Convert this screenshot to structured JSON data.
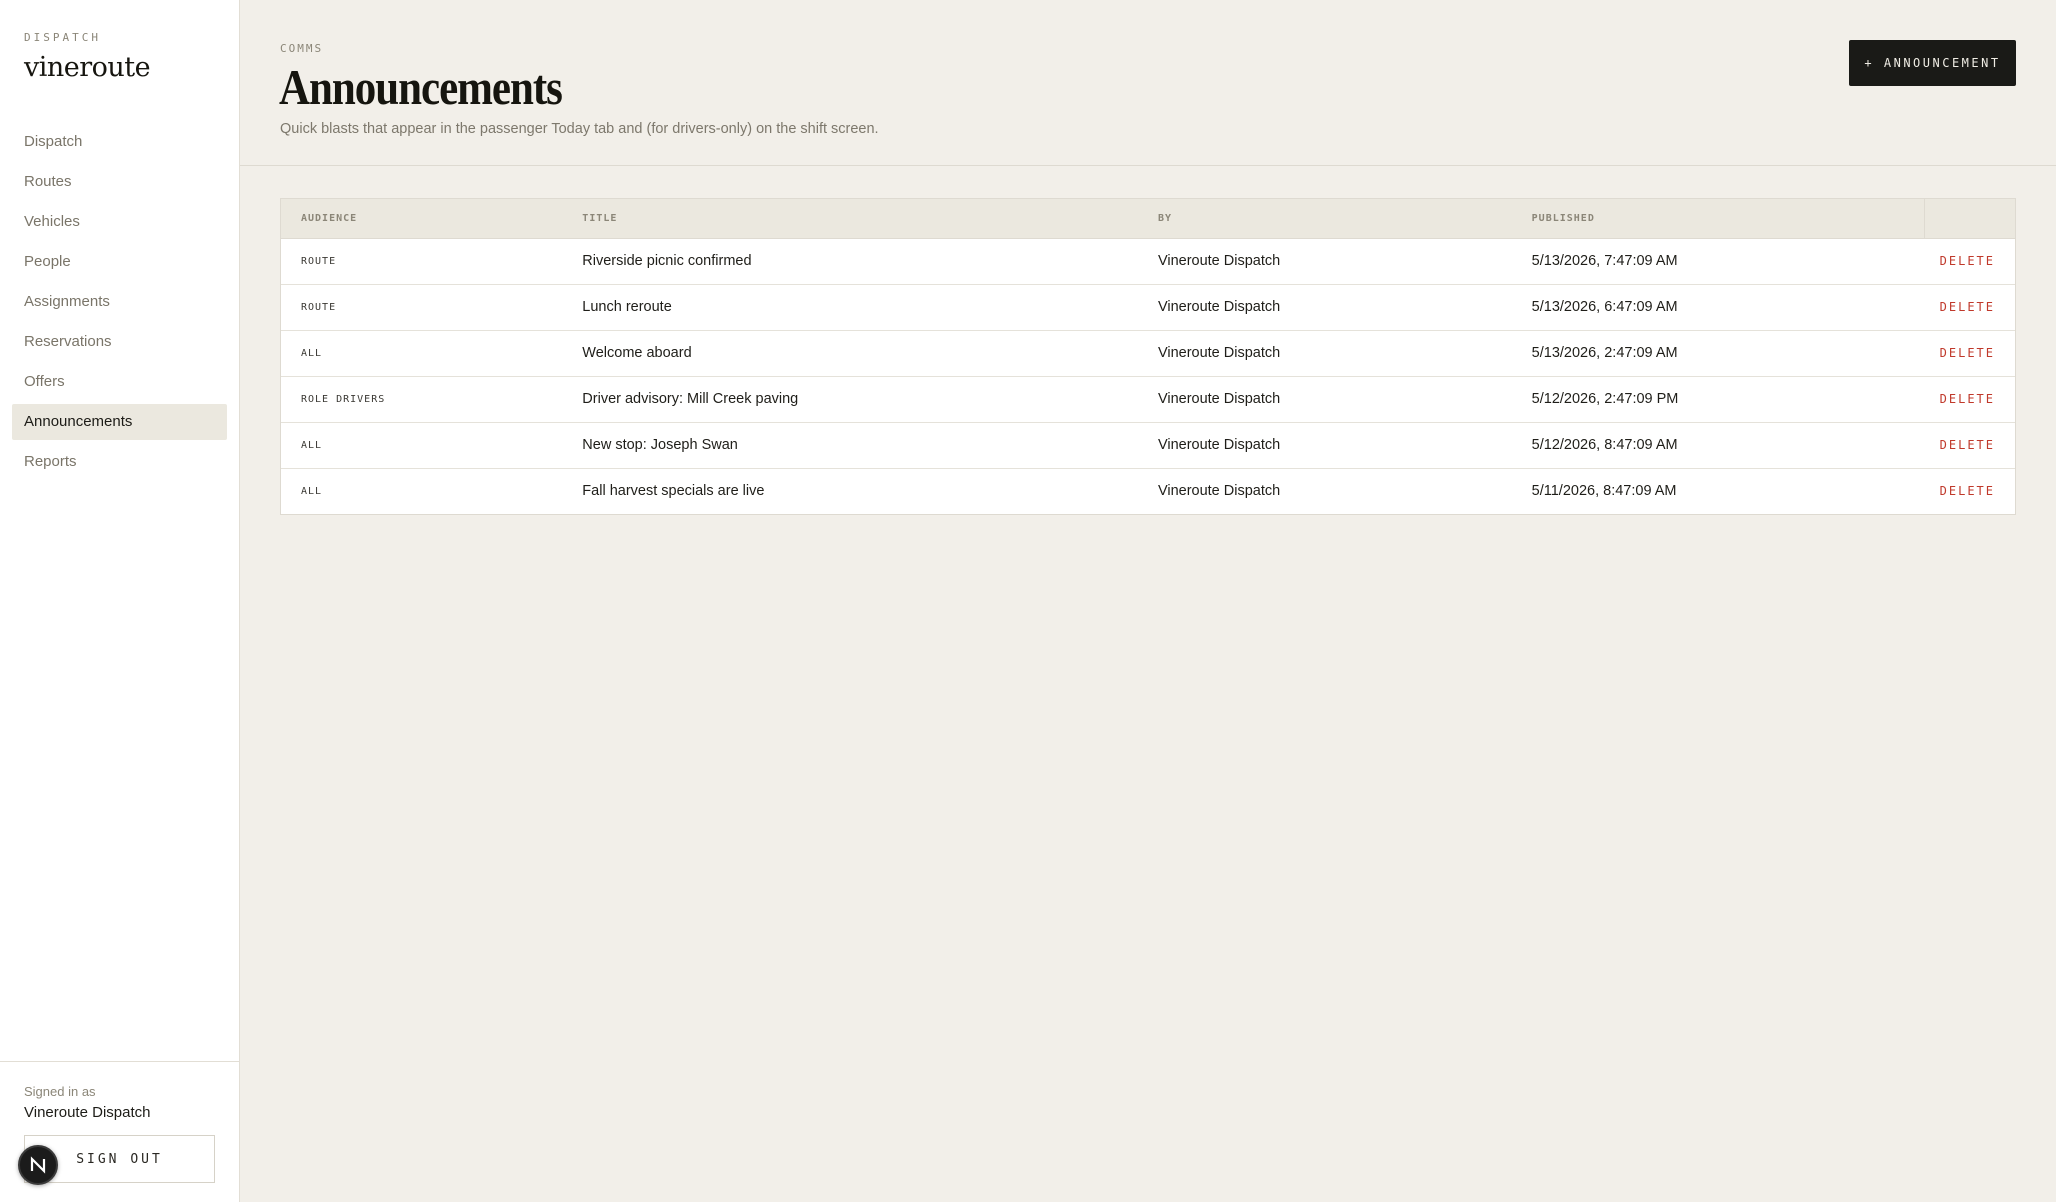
{
  "brand": {
    "eyebrow": "DISPATCH",
    "name": "vineroute"
  },
  "nav": {
    "items": [
      {
        "label": "Dispatch",
        "active": false
      },
      {
        "label": "Routes",
        "active": false
      },
      {
        "label": "Vehicles",
        "active": false
      },
      {
        "label": "People",
        "active": false
      },
      {
        "label": "Assignments",
        "active": false
      },
      {
        "label": "Reservations",
        "active": false
      },
      {
        "label": "Offers",
        "active": false
      },
      {
        "label": "Announcements",
        "active": true
      },
      {
        "label": "Reports",
        "active": false
      }
    ]
  },
  "account": {
    "signed_in_label": "Signed in as",
    "user_name": "Vineroute Dispatch",
    "sign_out_label": "SIGN OUT",
    "badge_letter": "N"
  },
  "header": {
    "eyebrow": "COMMS",
    "title": "Announcements",
    "subtitle": "Quick blasts that appear in the passenger Today tab and (for drivers-only) on the shift screen.",
    "new_button_label": "+ ANNOUNCEMENT"
  },
  "table": {
    "columns": [
      "AUDIENCE",
      "TITLE",
      "BY",
      "PUBLISHED",
      ""
    ],
    "rows": [
      {
        "audience": "ROUTE",
        "title": "Riverside picnic confirmed",
        "by": "Vineroute Dispatch",
        "published": "5/13/2026, 7:47:09 AM",
        "action": "DELETE"
      },
      {
        "audience": "ROUTE",
        "title": "Lunch reroute",
        "by": "Vineroute Dispatch",
        "published": "5/13/2026, 6:47:09 AM",
        "action": "DELETE"
      },
      {
        "audience": "ALL",
        "title": "Welcome aboard",
        "by": "Vineroute Dispatch",
        "published": "5/13/2026, 2:47:09 AM",
        "action": "DELETE"
      },
      {
        "audience": "ROLE DRIVERS",
        "title": "Driver advisory: Mill Creek paving",
        "by": "Vineroute Dispatch",
        "published": "5/12/2026, 2:47:09 PM",
        "action": "DELETE"
      },
      {
        "audience": "ALL",
        "title": "New stop: Joseph Swan",
        "by": "Vineroute Dispatch",
        "published": "5/12/2026, 8:47:09 AM",
        "action": "DELETE"
      },
      {
        "audience": "ALL",
        "title": "Fall harvest specials are live",
        "by": "Vineroute Dispatch",
        "published": "5/11/2026, 8:47:09 AM",
        "action": "DELETE"
      }
    ]
  },
  "colors": {
    "background": "#f2efe9",
    "sidebar": "#ffffff",
    "active_nav": "#ebe8df",
    "primary_button": "#1a1a17",
    "danger": "#c0392b"
  }
}
